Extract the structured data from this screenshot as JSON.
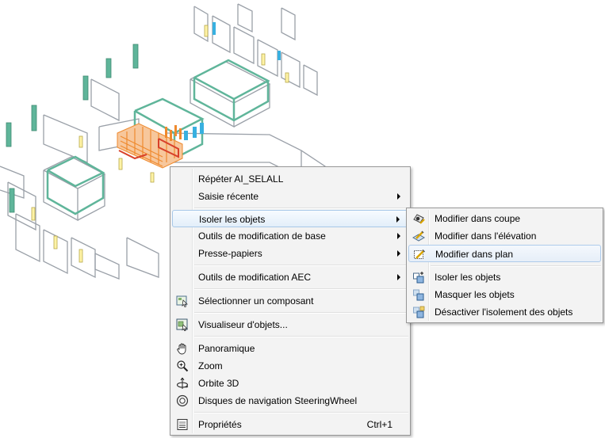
{
  "context_menu": {
    "items": [
      {
        "label": "Répéter AI_SELALL"
      },
      {
        "label": "Saisie récente"
      },
      {
        "label": "Isoler les objets"
      },
      {
        "label": "Outils de modification de base"
      },
      {
        "label": "Presse-papiers"
      },
      {
        "label": "Outils de modification AEC"
      },
      {
        "label": "Sélectionner un composant",
        "icon": "select-component-icon"
      },
      {
        "label": "Visualiseur d'objets...",
        "icon": "object-viewer-icon"
      },
      {
        "label": "Panoramique",
        "icon": "pan-hand-icon"
      },
      {
        "label": "Zoom",
        "icon": "zoom-icon"
      },
      {
        "label": "Orbite 3D",
        "icon": "orbit-icon"
      },
      {
        "label": "Disques de navigation SteeringWheel",
        "icon": "steeringwheel-icon"
      },
      {
        "label": "Propriétés",
        "icon": "properties-icon",
        "shortcut": "Ctrl+1"
      }
    ]
  },
  "submenu": {
    "items": [
      {
        "label": "Modifier dans coupe",
        "icon": "edit-in-section-icon"
      },
      {
        "label": "Modifier dans l'élévation",
        "icon": "edit-in-elevation-icon"
      },
      {
        "label": "Modifier dans plan",
        "icon": "edit-in-plan-icon"
      },
      {
        "label": "Isoler les objets",
        "icon": "isolate-objects-icon"
      },
      {
        "label": "Masquer les objets",
        "icon": "hide-objects-icon"
      },
      {
        "label": "Désactiver l'isolement des objets",
        "icon": "end-isolation-icon"
      }
    ]
  },
  "colors": {
    "wall": "#9aa0a8",
    "wall_highlight": "#5fb59a",
    "selection_orange": "#ef8a2e",
    "selection_red": "#d8402a",
    "accent_cyan": "#38b0e0",
    "menu_background": "#f3f3f3",
    "menu_hover": "#e3eef9"
  }
}
